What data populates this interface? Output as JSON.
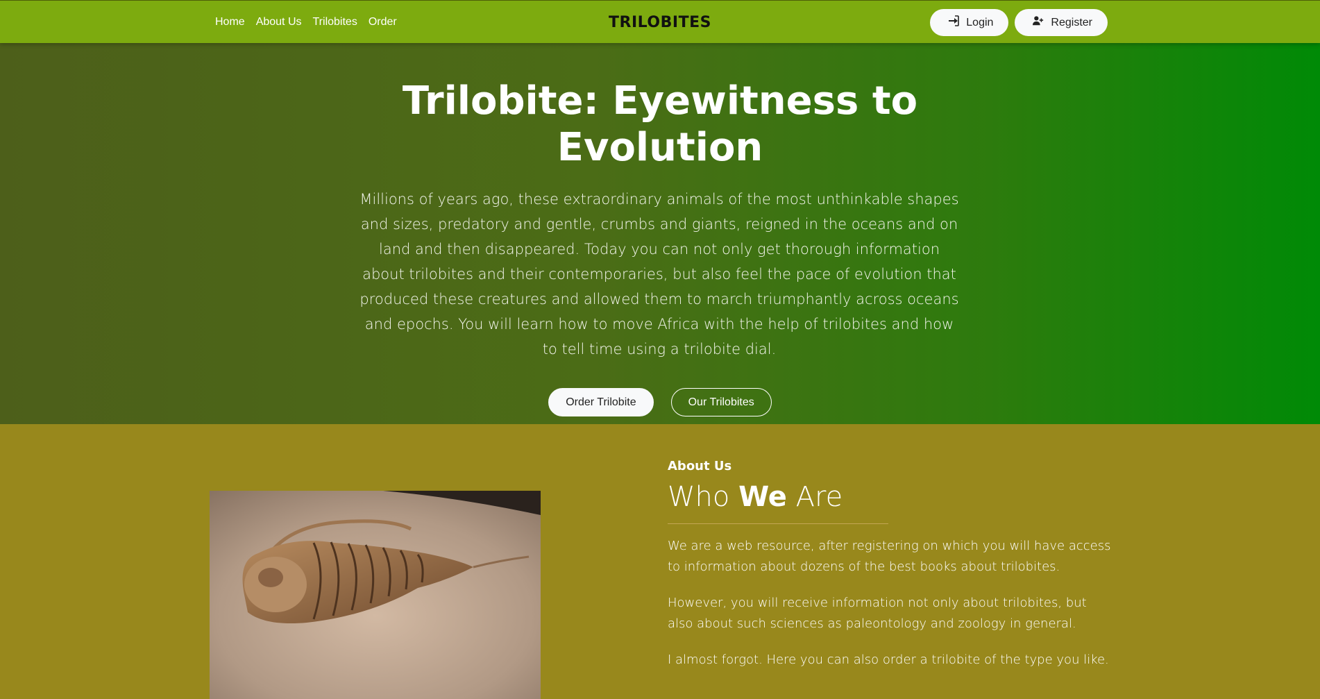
{
  "nav": {
    "links": [
      "Home",
      "About Us",
      "Trilobites",
      "Order"
    ],
    "brand": "TRILOBITES",
    "login_label": "Login",
    "register_label": "Register"
  },
  "hero": {
    "title_line1": "Trilobite: Eyewitness to",
    "title_line2": "Evolution",
    "description": "Millions of years ago, these extraordinary animals of the most unthinkable shapes and sizes, predatory and gentle, crumbs and giants, reigned in the oceans and on land and then disappeared. Today you can not only get thorough information about trilobites and their contemporaries, but also feel the pace of evolution that produced these creatures and allowed them to march triumphantly across oceans and epochs. You will learn how to move Africa with the help of trilobites and how to tell time using a trilobite dial.",
    "order_button": "Order Trilobite",
    "our_button": "Our Trilobites"
  },
  "about": {
    "eyebrow": "About Us",
    "heading_pre": "Who ",
    "heading_bold": "We",
    "heading_post": " Are",
    "paragraphs": [
      "We are a web resource, after registering on which you will have access to information about dozens of the best books about trilobites.",
      "However, you will receive information not only about trilobites, but also about such sciences as paleontology and zoology in general.",
      "I almost forgot. Here you can also order a trilobite of the type you like."
    ]
  },
  "colors": {
    "navbar": "#7dab0f",
    "hero_gradient_start": "#4d5f1a",
    "hero_gradient_end": "#008a06",
    "about_bg": "#98881c"
  },
  "icons": {
    "login": "sign-in-icon",
    "register": "user-plus-icon"
  }
}
